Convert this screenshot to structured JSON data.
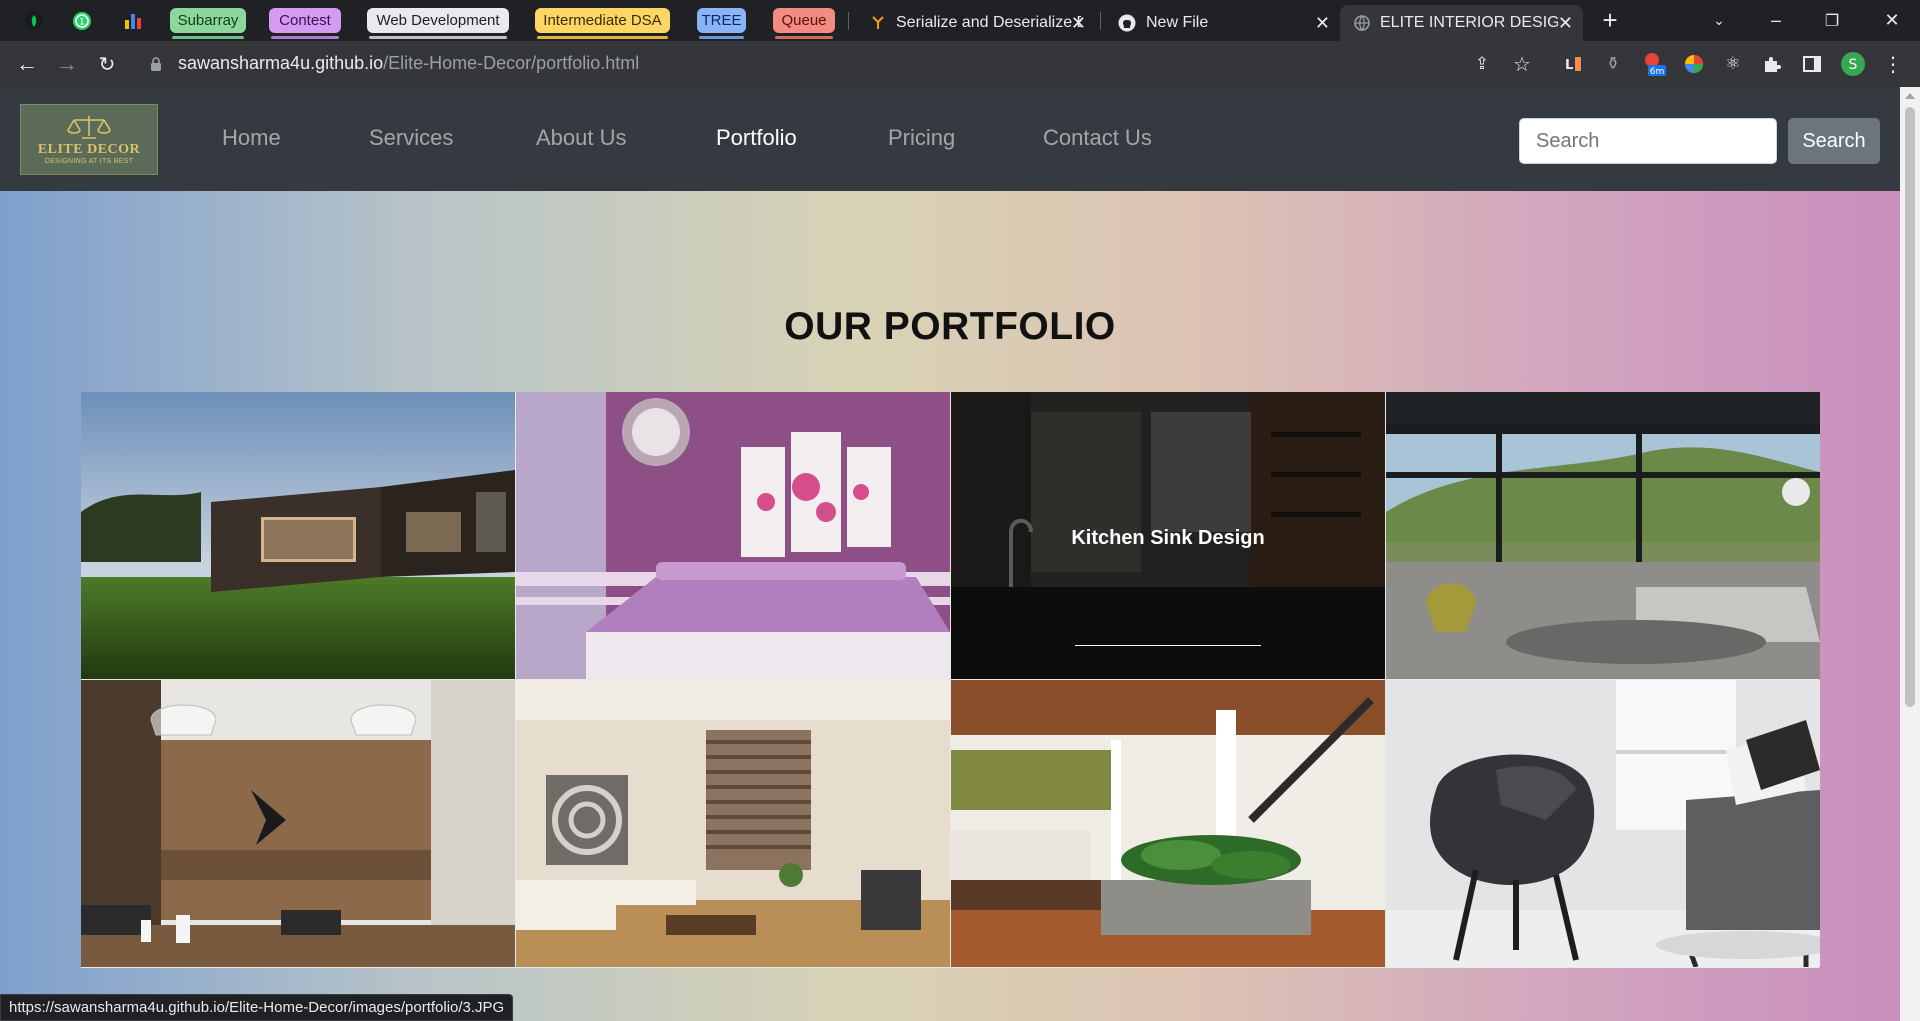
{
  "browser": {
    "bookmark_pills": [
      {
        "label": "Subarray",
        "bg": "#8ed79c",
        "text": "#0b3d17",
        "underline": "#6fbf80"
      },
      {
        "label": "Contest",
        "bg": "#d59bf0",
        "text": "#3b1251",
        "underline": "#b07ad0"
      },
      {
        "label": "Web Development",
        "bg": "#e8eaed",
        "text": "#202124",
        "underline": "#bdc1c6"
      },
      {
        "label": "Intermediate DSA",
        "bg": "#fdd663",
        "text": "#3c2a00",
        "underline": "#e0b53a"
      },
      {
        "label": "TREE",
        "bg": "#8ab4f8",
        "text": "#0b2a5e",
        "underline": "#6b96d9"
      },
      {
        "label": "Queue",
        "bg": "#f28b82",
        "text": "#5c0f08",
        "underline": "#d36b62"
      }
    ],
    "tabs": [
      {
        "title": "Serialize and Deserialize B",
        "icon": "gfg-icon"
      },
      {
        "title": "New File",
        "icon": "github-icon"
      },
      {
        "title": "ELITE INTERIOR DESIGNING",
        "icon": "globe-icon"
      }
    ],
    "url_host": "sawansharma4u.github.io",
    "url_path": "/Elite-Home-Decor/portfolio.html",
    "extension_badge": "6m",
    "profile_initial": "S",
    "status_url": "https://sawansharma4u.github.io/Elite-Home-Decor/images/portfolio/3.JPG"
  },
  "site": {
    "logo_title": "ELITE DECOR",
    "logo_tagline": "DESIGNING AT ITS BEST",
    "nav": [
      "Home",
      "Services",
      "About Us",
      "Portfolio",
      "Pricing",
      "Contact Us"
    ],
    "active_nav": "Portfolio",
    "search_placeholder": "Search",
    "search_button": "Search",
    "heading": "OUR PORTFOLIO",
    "hover_caption": "Kitchen Sink Design",
    "portfolio": [
      {
        "subject": "modern dark house exterior on grass"
      },
      {
        "subject": "purple bedroom with flower wall art"
      },
      {
        "subject": "dark kitchen sink"
      },
      {
        "subject": "open living room with mountain view"
      },
      {
        "subject": "wooden dining room with glass pendant lamps"
      },
      {
        "subject": "white living room with spiral art"
      },
      {
        "subject": "bedroom with indoor plants and stairs"
      },
      {
        "subject": "black leather armchair"
      }
    ]
  }
}
